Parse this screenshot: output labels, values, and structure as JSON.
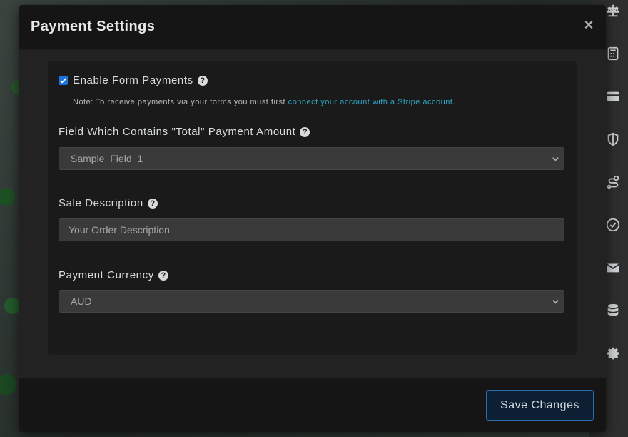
{
  "modal": {
    "title": "Payment Settings",
    "close_label": "×"
  },
  "enable_payments": {
    "label": "Enable Form Payments",
    "checked": true,
    "help": "?"
  },
  "note": {
    "prefix": "Note: To receive payments via your forms you must first ",
    "link_text": "connect your account with a Stripe account",
    "suffix": "."
  },
  "total_field": {
    "label": "Field Which Contains \"Total\" Payment Amount",
    "help": "?",
    "selected": "Sample_Field_1"
  },
  "sale_description": {
    "label": "Sale Description",
    "help": "?",
    "placeholder": "Your Order Description"
  },
  "currency": {
    "label": "Payment Currency",
    "help": "?",
    "selected": "AUD"
  },
  "footer": {
    "save_label": "Save Changes"
  },
  "colors": {
    "accent": "#1d73d9",
    "link": "#2ea7c4",
    "save_border": "#2c6cae"
  },
  "side_icons": [
    "scale-icon",
    "calculator-icon",
    "credit-card-icon",
    "shield-icon",
    "route-icon",
    "check-circle-icon",
    "envelope-icon",
    "database-icon",
    "gear-icon"
  ]
}
